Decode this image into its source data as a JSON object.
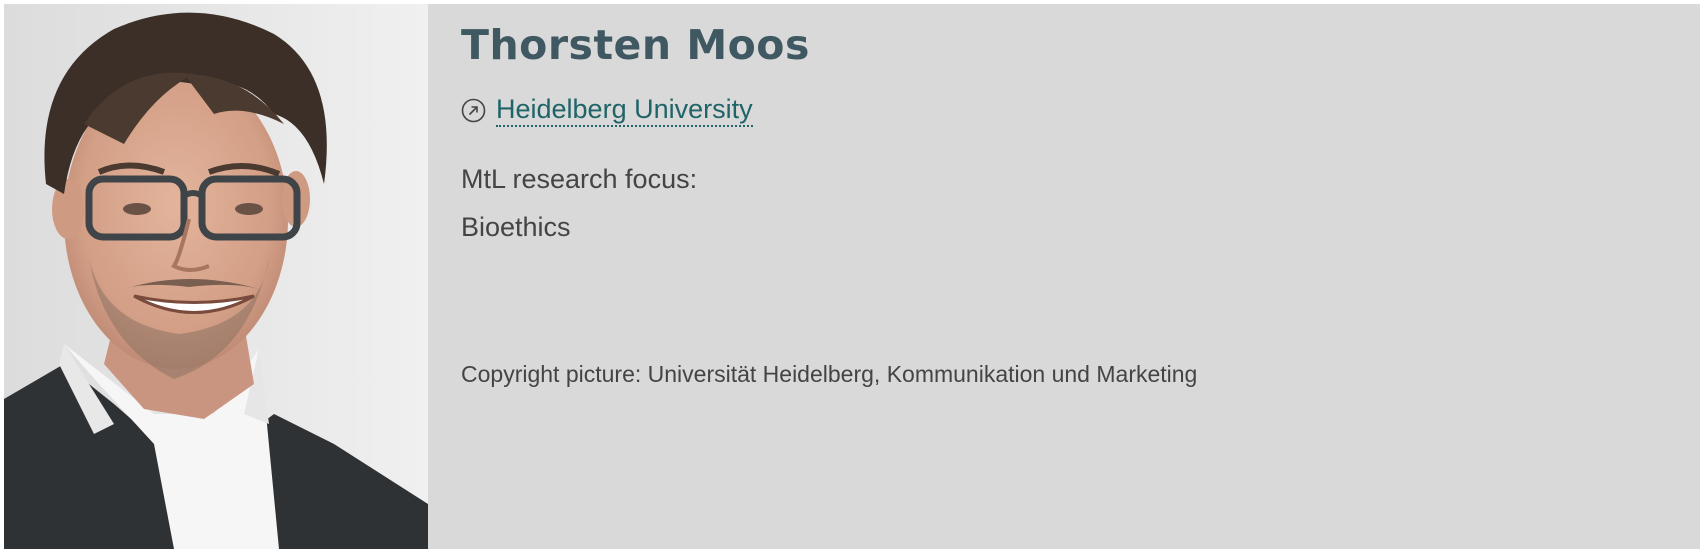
{
  "profile": {
    "name": "Thorsten Moos",
    "affiliation": "Heidelberg University",
    "affiliation_icon": "external-link-circle-icon",
    "focus_label": "MtL research focus:",
    "focus_value": "Bioethics",
    "copyright": "Copyright picture: Universität Heidelberg, Kommunikation und Marketing"
  },
  "colors": {
    "card_background": "#d9d9d9",
    "name": "#3f5862",
    "link": "#1f6468",
    "text": "#444444"
  }
}
